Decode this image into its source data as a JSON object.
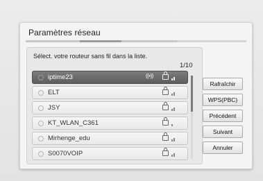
{
  "dialog": {
    "title": "Paramètres réseau",
    "prompt": "Sélect. votre routeur sans fil dans la liste.",
    "page_indicator": "1/10"
  },
  "networks": [
    {
      "ssid": "iptime23",
      "selected": true,
      "secured": true,
      "wps": true,
      "signal_bars": 2
    },
    {
      "ssid": "ELT",
      "selected": false,
      "secured": true,
      "wps": false,
      "signal_bars": 2
    },
    {
      "ssid": "JSY",
      "selected": false,
      "secured": true,
      "wps": false,
      "signal_bars": 2
    },
    {
      "ssid": "KT_WLAN_C361",
      "selected": false,
      "secured": true,
      "wps": false,
      "signal_bars": 1
    },
    {
      "ssid": "Mirhenge_edu",
      "selected": false,
      "secured": true,
      "wps": false,
      "signal_bars": 2
    },
    {
      "ssid": "S0070VOIP",
      "selected": false,
      "secured": true,
      "wps": false,
      "signal_bars": 2
    }
  ],
  "wps_badge": "((•))",
  "buttons": {
    "refresh": "Rafraîchir",
    "wps": "WPS(PBC)",
    "previous": "Précédent",
    "next": "Suivant",
    "cancel": "Annuler"
  },
  "colors": {
    "selected_row": "#6a6a6a",
    "background": "#e6e6e6"
  },
  "icons": {
    "lock": "lock-icon",
    "signal": "signal-strength-icon",
    "wps": "wps-icon"
  }
}
